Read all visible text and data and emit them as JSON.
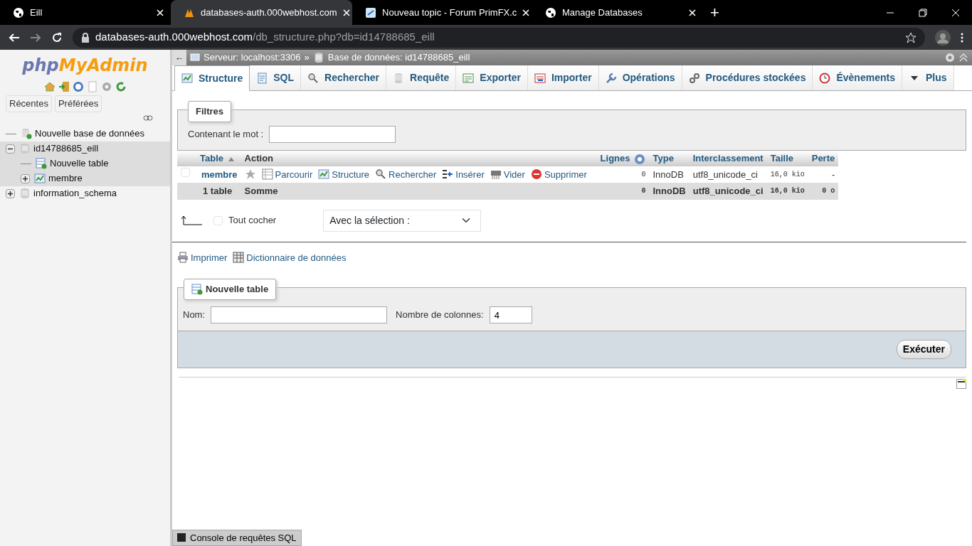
{
  "browser": {
    "tabs": [
      {
        "title": "Eill",
        "selected": false
      },
      {
        "title": "databases-auth.000webhost.com",
        "selected": true
      },
      {
        "title": "Nouveau topic - Forum PrimFX.c",
        "selected": false
      },
      {
        "title": "Manage Databases",
        "selected": false
      }
    ],
    "new_tab": "+",
    "url_host": "databases-auth.000webhost.com",
    "url_path": "/db_structure.php?db=id14788685_eill"
  },
  "sidebar": {
    "logo_first": "php",
    "logo_second": "MyAdmin",
    "buttons": [
      "Récentes",
      "Préférées"
    ],
    "tree": [
      {
        "label": "Nouvelle base de données",
        "kind": "new_database",
        "selected": false
      },
      {
        "label": "id14788685_eill",
        "kind": "database",
        "expanded": true,
        "selected": true,
        "children": [
          {
            "label": "Nouvelle table",
            "kind": "new_table",
            "selected": false
          },
          {
            "label": "membre",
            "kind": "table",
            "expanded": false,
            "selected": false
          }
        ]
      },
      {
        "label": "information_schema",
        "kind": "database",
        "expanded": false,
        "selected": false
      }
    ]
  },
  "breadcrumb": {
    "back": "←",
    "server": "Serveur: localhost:3306",
    "separator": "»",
    "database": "Base de données: id14788685_eill"
  },
  "tabs": [
    {
      "label": "Structure",
      "selected": true
    },
    {
      "label": "SQL",
      "selected": false
    },
    {
      "label": "Rechercher",
      "selected": false
    },
    {
      "label": "Requête",
      "selected": false
    },
    {
      "label": "Exporter",
      "selected": false
    },
    {
      "label": "Importer",
      "selected": false
    },
    {
      "label": "Opérations",
      "selected": false
    },
    {
      "label": "Procédures stockées",
      "selected": false
    },
    {
      "label": "Évènements",
      "selected": false
    },
    {
      "label": "Plus",
      "selected": false
    }
  ],
  "filter": {
    "legend": "Filtres",
    "label": "Contenant le mot :"
  },
  "table": {
    "columns": [
      "Table",
      "Action",
      "Lignes",
      "Type",
      "Interclassement",
      "Taille",
      "Perte"
    ],
    "rows": [
      {
        "checked": false,
        "name": "membre",
        "favorite": false,
        "actions": [
          "Parcourir",
          "Structure",
          "Rechercher",
          "Insérer",
          "Vider",
          "Supprimer"
        ],
        "rows_count": "0",
        "type": "InnoDB",
        "collation": "utf8_unicode_ci",
        "size": "16,0 kio",
        "overhead": "-"
      }
    ],
    "footer": {
      "name": "1 table",
      "action": "Somme",
      "rows_count": "0",
      "type": "InnoDB",
      "collation": "utf8_unicode_ci",
      "size": "16,0 kio",
      "overhead": "0 o"
    }
  },
  "check_all": {
    "label": "Tout cocher",
    "checked": false,
    "selection": "Avec la sélection :"
  },
  "links": [
    "Imprimer",
    "Dictionnaire de données"
  ],
  "new_table": {
    "legend": "Nouvelle table",
    "name_label": "Nom:",
    "columns_label": "Nombre de colonnes:",
    "columns_value": "4",
    "submit": "Exécuter"
  },
  "console": "Console de requêtes SQL"
}
